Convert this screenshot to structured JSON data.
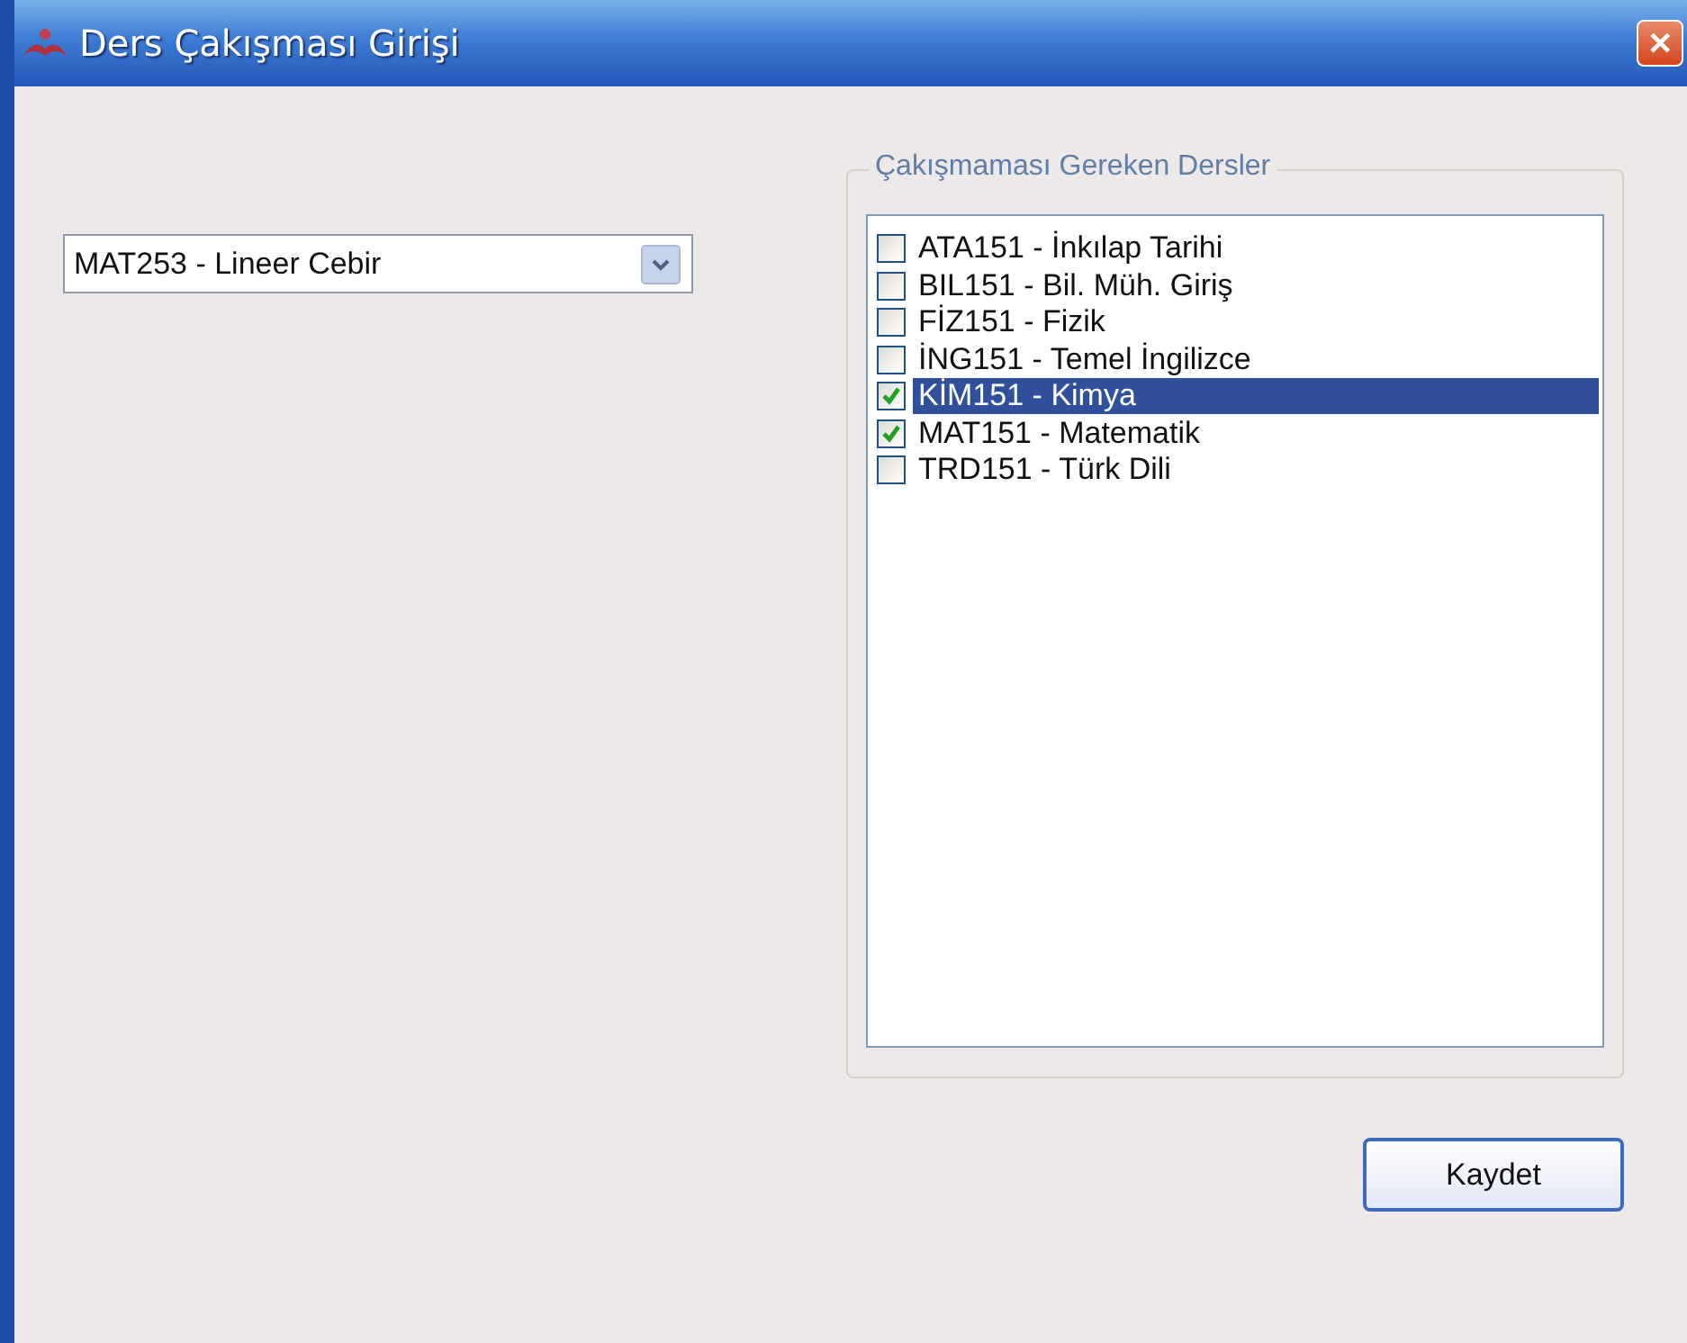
{
  "window": {
    "title": "Ders Çakışması Girişi",
    "close_label": "✕"
  },
  "course_select": {
    "value": "MAT253 - Lineer Cebir"
  },
  "group": {
    "legend": "Çakışmaması Gereken Dersler",
    "items": [
      {
        "label": "ATA151 - İnkılap Tarihi",
        "checked": false,
        "selected": false
      },
      {
        "label": "BIL151 - Bil. Müh. Giriş",
        "checked": false,
        "selected": false
      },
      {
        "label": "FİZ151 - Fizik",
        "checked": false,
        "selected": false
      },
      {
        "label": "İNG151 - Temel İngilizce",
        "checked": false,
        "selected": false
      },
      {
        "label": "KİM151 - Kimya",
        "checked": true,
        "selected": true
      },
      {
        "label": "MAT151 - Matematik",
        "checked": true,
        "selected": false
      },
      {
        "label": "TRD151 - Türk Dili",
        "checked": false,
        "selected": false
      }
    ]
  },
  "buttons": [
    {
      "label": "Kaydet"
    }
  ]
}
